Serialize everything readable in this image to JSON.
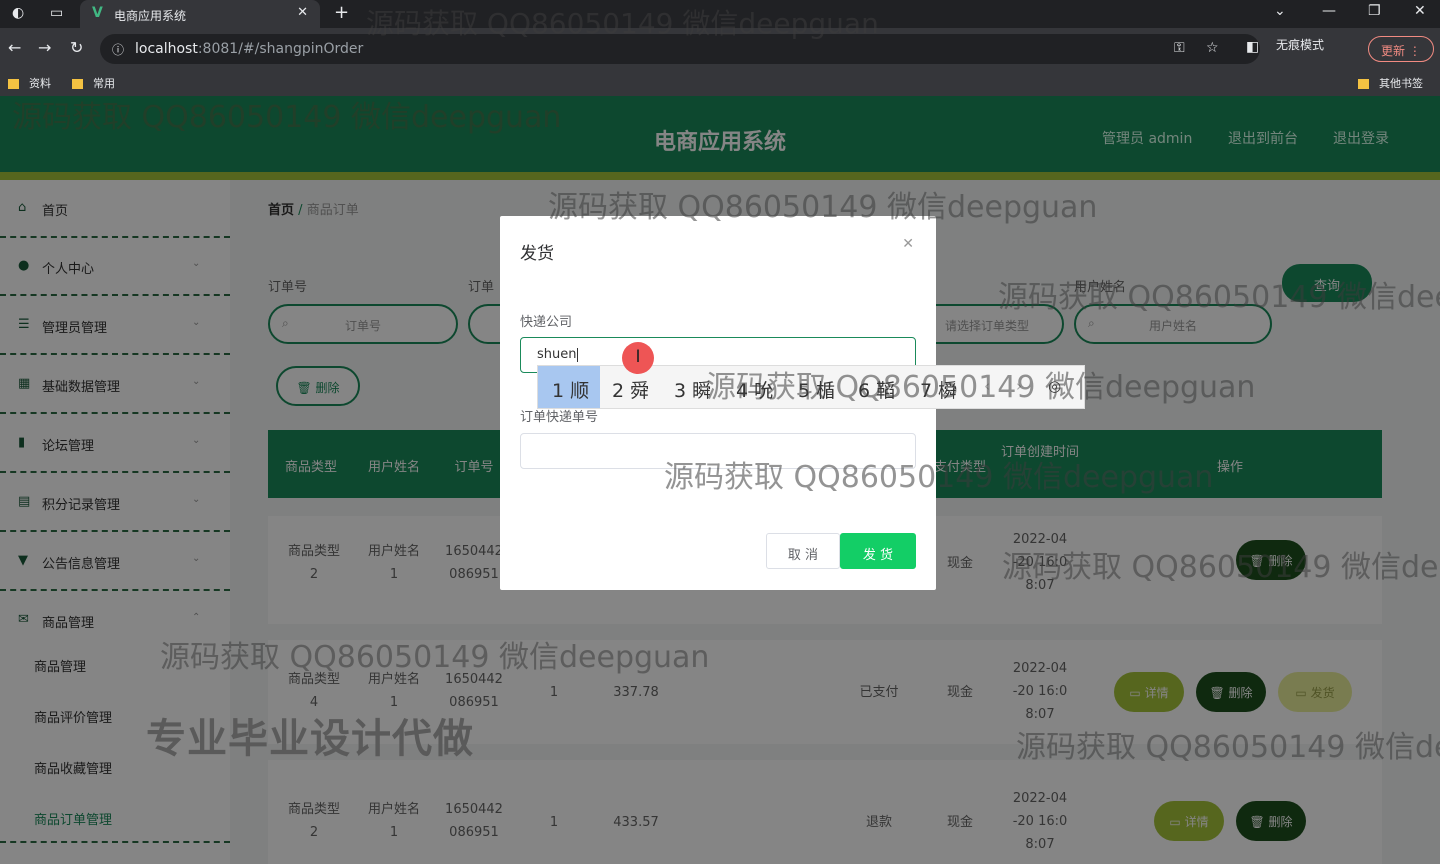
{
  "browser": {
    "tab_title": "电商应用系统",
    "tab_favicon": "V",
    "url_host": "localhost",
    "url_rest": ":8081/#/shangpinOrder",
    "incognito_label": "无痕模式",
    "update_label": "更新",
    "bookmarks": [
      "资料",
      "常用"
    ],
    "other_bookmarks": "其他书签"
  },
  "header": {
    "title": "电商应用系统",
    "user": "管理员 admin",
    "to_front": "退出到前台",
    "logout": "退出登录"
  },
  "sidebar": {
    "items": [
      {
        "label": "首页",
        "icon": "home-icon"
      },
      {
        "label": "个人中心",
        "icon": "user-icon"
      },
      {
        "label": "管理员管理",
        "icon": "list-icon"
      },
      {
        "label": "基础数据管理",
        "icon": "grid-icon"
      },
      {
        "label": "论坛管理",
        "icon": "bar-chart-icon"
      },
      {
        "label": "积分记录管理",
        "icon": "calendar-icon"
      },
      {
        "label": "公告信息管理",
        "icon": "trophy-icon"
      },
      {
        "label": "商品管理",
        "icon": "mail-icon"
      }
    ],
    "subitems": [
      "商品管理",
      "商品评价管理",
      "商品收藏管理",
      "商品订单管理"
    ]
  },
  "breadcrumb": {
    "home": "首页",
    "current": "商品订单"
  },
  "filters": {
    "label1": "订单号",
    "label2": "订单",
    "label3": "用户姓名",
    "placeholder1": "订单号",
    "placeholder_select": "请选择订单类型",
    "placeholder_user": "用户姓名",
    "search_btn": "查询",
    "delete_btn": "删除"
  },
  "table": {
    "headers": [
      "商品类型",
      "用户姓名",
      "订单号",
      "支付类型",
      "订单创建时间",
      "操作"
    ],
    "rows": [
      {
        "type": "商品类型\n2",
        "user": "用户姓名\n1",
        "order": "1650442\n086951",
        "count": "",
        "price": "",
        "status": "",
        "pay": "现金",
        "time": "2022-04\n-20 16:0\n8:07",
        "actions": [
          "删除"
        ]
      },
      {
        "type": "商品类型\n4",
        "user": "用户姓名\n1",
        "order": "1650442\n086951",
        "count": "1",
        "price": "337.78",
        "status": "已支付",
        "pay": "现金",
        "time": "2022-04\n-20 16:0\n8:07",
        "actions": [
          "详情",
          "删除",
          "发货"
        ]
      },
      {
        "type": "商品类型\n2",
        "user": "用户姓名\n1",
        "order": "1650442\n086951",
        "count": "1",
        "price": "433.57",
        "status": "退款",
        "pay": "现金",
        "time": "2022-04\n-20 16:0\n8:07",
        "actions": [
          "详情",
          "删除"
        ]
      }
    ]
  },
  "dialog": {
    "title": "发货",
    "label_company": "快递公司",
    "company_value": "shuen",
    "label_tracking": "订单快递单号",
    "tracking_value": "",
    "cancel": "取 消",
    "confirm": "发 货"
  },
  "ime": {
    "candidates": [
      {
        "n": "1",
        "c": "顺"
      },
      {
        "n": "2",
        "c": "舜"
      },
      {
        "n": "3",
        "c": "瞬"
      },
      {
        "n": "4",
        "c": "吮"
      },
      {
        "n": "5",
        "c": "楯"
      },
      {
        "n": "6",
        "c": "鞱"
      },
      {
        "n": "7",
        "c": "橓"
      }
    ]
  },
  "watermarks": {
    "main": "源码获取 QQ86050149 微信deepguan",
    "cut": "源码获取 QQ86050149 微信dee",
    "cut2": "源码获取 QQ86050149 微信de",
    "big": "专业毕业设计代做"
  },
  "colors": {
    "primary": "#1a8a5a",
    "accent": "#a6c43a",
    "confirm": "#13ce66"
  }
}
